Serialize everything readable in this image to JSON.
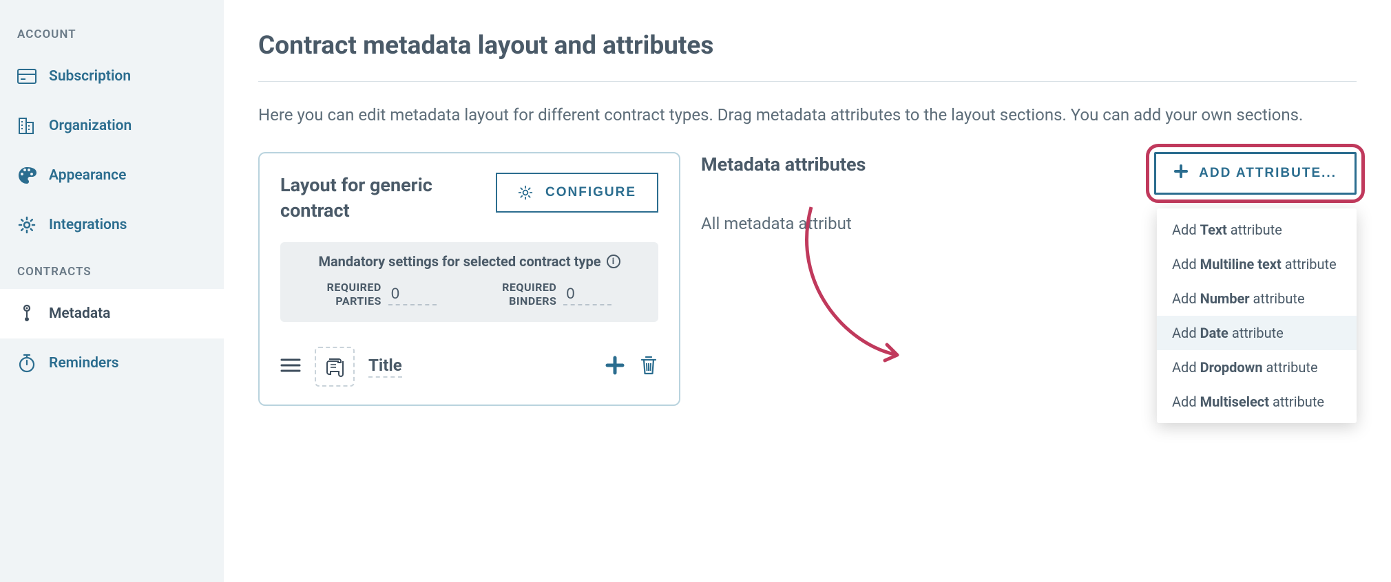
{
  "sidebar": {
    "sections": {
      "account": {
        "label": "ACCOUNT",
        "items": [
          {
            "label": "Subscription"
          },
          {
            "label": "Organization"
          },
          {
            "label": "Appearance"
          },
          {
            "label": "Integrations"
          }
        ]
      },
      "contracts": {
        "label": "CONTRACTS",
        "items": [
          {
            "label": "Metadata"
          },
          {
            "label": "Reminders"
          }
        ]
      }
    }
  },
  "page": {
    "title": "Contract metadata layout and attributes",
    "description": "Here you can edit metadata layout for different contract types. Drag metadata attributes to the layout sections. You can add your own sections."
  },
  "layoutPanel": {
    "title": "Layout for generic contract",
    "configureLabel": "CONFIGURE",
    "mandatory": {
      "title": "Mandatory settings for selected contract type",
      "parties": {
        "label": "REQUIRED PARTIES",
        "value": "0"
      },
      "binders": {
        "label": "REQUIRED BINDERS",
        "value": "0"
      }
    },
    "row": {
      "label": "Title"
    }
  },
  "attrs": {
    "title": "Metadata attributes",
    "addLabel": "ADD ATTRIBUTE...",
    "description": "All metadata attribut",
    "dropdown": [
      {
        "prefix": "Add ",
        "bold": "Text",
        "suffix": " attribute"
      },
      {
        "prefix": "Add ",
        "bold": "Multiline text",
        "suffix": " attribute"
      },
      {
        "prefix": "Add ",
        "bold": "Number",
        "suffix": " attribute"
      },
      {
        "prefix": "Add ",
        "bold": "Date",
        "suffix": " attribute"
      },
      {
        "prefix": "Add ",
        "bold": "Dropdown",
        "suffix": " attribute"
      },
      {
        "prefix": "Add ",
        "bold": "Multiselect",
        "suffix": " attribute"
      }
    ]
  }
}
